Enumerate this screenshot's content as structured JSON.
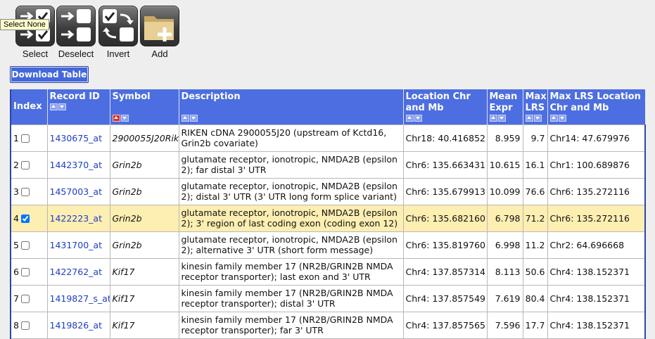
{
  "toolbar": {
    "tooltip": "Select None",
    "buttons": [
      {
        "label": "Select"
      },
      {
        "label": "Deselect"
      },
      {
        "label": "Invert"
      },
      {
        "label": "Add"
      }
    ]
  },
  "download_button": "Download Table",
  "table": {
    "headers": {
      "index": "Index",
      "record_id": "Record ID",
      "symbol": "Symbol",
      "description": "Description",
      "location": "Location Chr and Mb",
      "mean_expr": "Mean Expr",
      "max_lrs": "Max LRS",
      "max_lrs_location": "Max LRS Location Chr and Mb"
    },
    "rows": [
      {
        "index": "1",
        "checked": false,
        "record_id": "1430675_at",
        "symbol": "2900055J20Rik",
        "description": "RIKEN cDNA 2900055J20 (upstream of Kctd16, Grin2b covariate)",
        "location": "Chr18: 40.416852",
        "mean_expr": "8.959",
        "max_lrs": "9.7",
        "max_lrs_location": "Chr14: 47.679976"
      },
      {
        "index": "2",
        "checked": false,
        "record_id": "1442370_at",
        "symbol": "Grin2b",
        "description": "glutamate receptor, ionotropic, NMDA2B (epsilon 2); far distal 3' UTR",
        "location": "Chr6: 135.663431",
        "mean_expr": "10.615",
        "max_lrs": "16.1",
        "max_lrs_location": "Chr1: 100.689876"
      },
      {
        "index": "3",
        "checked": false,
        "record_id": "1457003_at",
        "symbol": "Grin2b",
        "description": "glutamate receptor, ionotropic, NMDA2B (epsilon 2); distal 3' UTR (3' UTR long form splice variant)",
        "location": "Chr6: 135.679913",
        "mean_expr": "10.099",
        "max_lrs": "76.6",
        "max_lrs_location": "Chr6: 135.272116"
      },
      {
        "index": "4",
        "checked": true,
        "record_id": "1422223_at",
        "symbol": "Grin2b",
        "description": "glutamate receptor, ionotropic, NMDA2B (epsilon 2); 3' region of last coding exon (coding exon 12)",
        "location": "Chr6: 135.682160",
        "mean_expr": "6.798",
        "max_lrs": "71.2",
        "max_lrs_location": "Chr6: 135.272116"
      },
      {
        "index": "5",
        "checked": false,
        "record_id": "1431700_at",
        "symbol": "Grin2b",
        "description": "glutamate receptor, ionotropic, NMDA2B (epsilon 2); alternative 3' UTR (short form message)",
        "location": "Chr6: 135.819760",
        "mean_expr": "6.998",
        "max_lrs": "11.2",
        "max_lrs_location": "Chr2: 64.696668"
      },
      {
        "index": "6",
        "checked": false,
        "record_id": "1422762_at",
        "symbol": "Kif17",
        "description": "kinesin family member 17 (NR2B/GRIN2B NMDA receptor transporter); last exon and 3' UTR",
        "location": "Chr4: 137.857314",
        "mean_expr": "8.113",
        "max_lrs": "50.6",
        "max_lrs_location": "Chr4: 138.152371"
      },
      {
        "index": "7",
        "checked": false,
        "record_id": "1419827_s_at",
        "symbol": "Kif17",
        "description": "kinesin family member 17 (NR2B/GRIN2B NMDA receptor transporter); distal 3' UTR",
        "location": "Chr4: 137.857549",
        "mean_expr": "7.619",
        "max_lrs": "80.4",
        "max_lrs_location": "Chr4: 138.152371"
      },
      {
        "index": "8",
        "checked": false,
        "record_id": "1419826_at",
        "symbol": "Kif17",
        "description": "kinesin family member 17 (NR2B/GRIN2B NMDA receptor transporter); far 3' UTR",
        "location": "Chr4: 137.857565",
        "mean_expr": "7.596",
        "max_lrs": "17.7",
        "max_lrs_location": "Chr4: 138.152371"
      }
    ]
  }
}
